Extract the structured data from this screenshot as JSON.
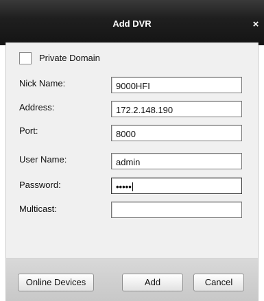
{
  "window": {
    "title": "Add DVR",
    "close_glyph": "×"
  },
  "form": {
    "private_domain": {
      "label": "Private Domain",
      "checked": false
    },
    "nick_name": {
      "label": "Nick Name:",
      "value": "9000HFI"
    },
    "address": {
      "label": "Address:",
      "value": "172.2.148.190"
    },
    "port": {
      "label": "Port:",
      "value": "8000"
    },
    "user_name": {
      "label": "User Name:",
      "value": "admin"
    },
    "password": {
      "label": "Password:",
      "masked_value": "•••••"
    },
    "multicast": {
      "label": "Multicast:",
      "value": ""
    }
  },
  "buttons": {
    "online_devices": "Online Devices",
    "add": "Add",
    "cancel": "Cancel"
  }
}
